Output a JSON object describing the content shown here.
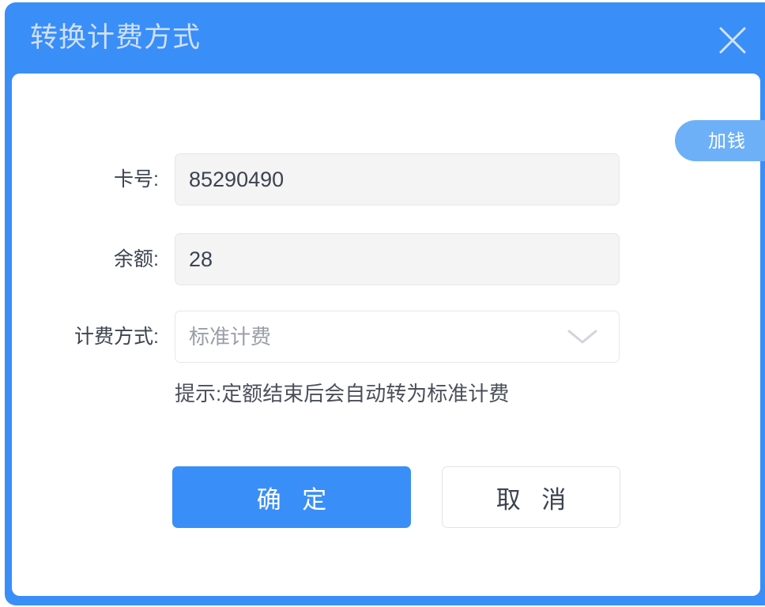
{
  "dialog": {
    "title": "转换计费方式",
    "close_icon": "close-x-icon",
    "header_color": "#3a8ef7",
    "title_color": "#cfe0fa"
  },
  "add_money": {
    "label": "加钱",
    "color": "#6db0f8"
  },
  "form": {
    "fields": [
      {
        "name": "card-number",
        "label": "卡号:",
        "value": "85290490",
        "placeholder": "",
        "type": "text"
      },
      {
        "name": "balance",
        "label": "余额:",
        "value": "28",
        "placeholder": "",
        "type": "text"
      },
      {
        "name": "billing-method",
        "label": "计费方式:",
        "value": "标准计费",
        "placeholder": "标准计费",
        "type": "select",
        "icon": "chevron-down-icon"
      }
    ],
    "hint": "提示:定额结束后会自动转为标准计费"
  },
  "actions": {
    "confirm_label": "确 定",
    "cancel_label": "取 消",
    "confirm_color": "#3a8ef7"
  }
}
